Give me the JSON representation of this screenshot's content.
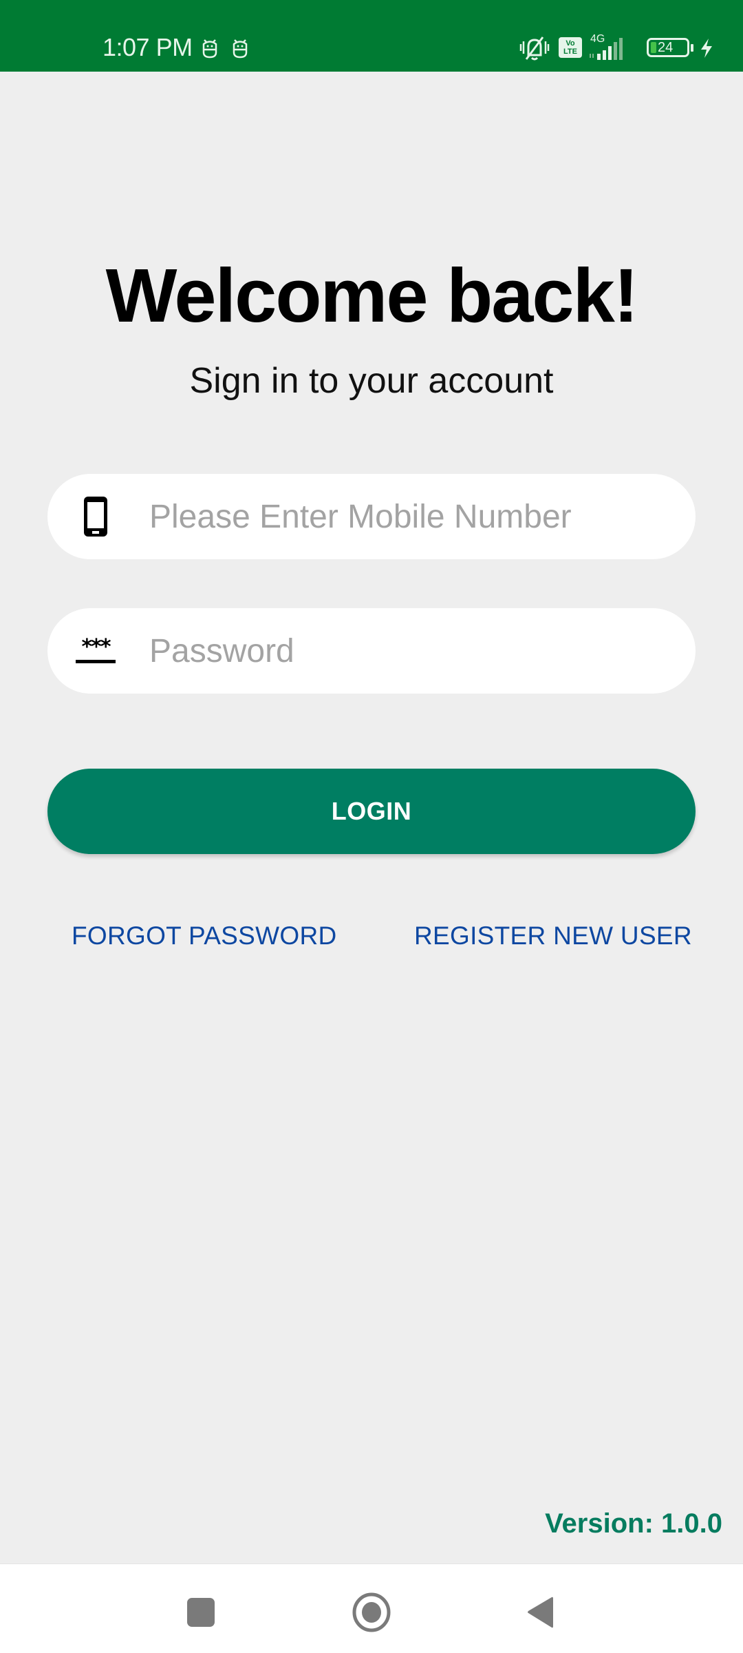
{
  "status_bar": {
    "time": "1:07 PM",
    "left_icons": [
      "robot-icon",
      "robot-icon"
    ],
    "right_icons": [
      "vibrate-bell-off-icon",
      "volte-icon",
      "signal-4g-icon",
      "battery-icon",
      "charging-icon"
    ],
    "volte_label_top": "Vo",
    "volte_label_bottom": "LTE",
    "network_type": "4G",
    "battery_level": "24",
    "background_color": "#007b33"
  },
  "login": {
    "title": "Welcome back!",
    "subtitle": "Sign in to your account",
    "mobile_field": {
      "icon": "smartphone-icon",
      "value": "",
      "placeholder": "Please Enter Mobile Number"
    },
    "password_field": {
      "icon": "password-icon",
      "icon_glyph": "***",
      "value": "",
      "placeholder": "Password"
    },
    "login_button": "LOGIN",
    "forgot_password_link": "FORGOT PASSWORD",
    "register_link": "REGISTER NEW USER",
    "version": "Version: 1.0.0",
    "accent_color": "#007e62",
    "link_color": "#0d47a1"
  },
  "nav_bar": {
    "buttons": [
      "recents",
      "home",
      "back"
    ]
  }
}
